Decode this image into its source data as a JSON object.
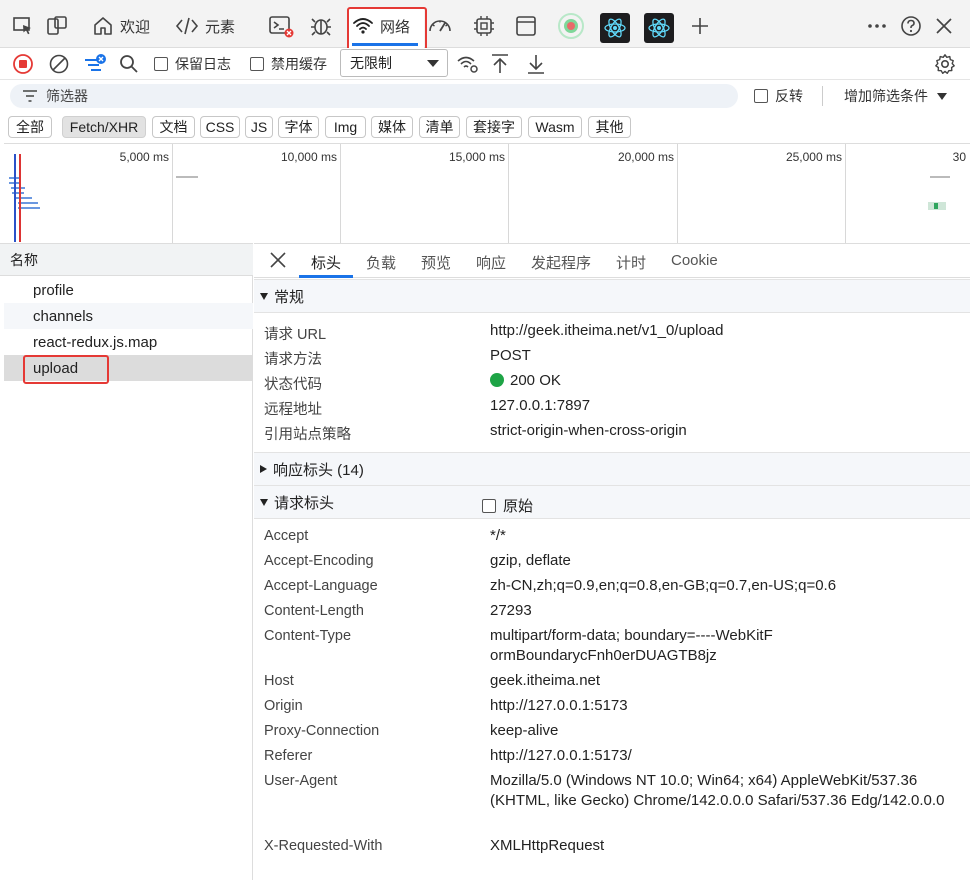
{
  "tabbar": {
    "welcome_label": "欢迎",
    "elements_label": "元素",
    "network_label": "网络"
  },
  "toolbar": {
    "preserve_log_label": "保留日志",
    "disable_cache_label": "禁用缓存",
    "throttling_value": "无限制"
  },
  "filter": {
    "placeholder": "筛选器",
    "invert_label": "反转",
    "more_filters_label": "增加筛选条件"
  },
  "type_filters": [
    "全部",
    "Fetch/XHR",
    "文档",
    "CSS",
    "JS",
    "字体",
    "Img",
    "媒体",
    "清单",
    "套接字",
    "Wasm",
    "其他"
  ],
  "selected_type_filter": "Fetch/XHR",
  "overview": {
    "ticks": [
      "5,000 ms",
      "10,000 ms",
      "15,000 ms",
      "20,000 ms",
      "25,000 ms",
      "30"
    ]
  },
  "requests": {
    "header": "名称",
    "items": [
      "profile",
      "channels",
      "react-redux.js.map",
      "upload"
    ],
    "selected": "upload"
  },
  "detail": {
    "tabs": [
      "标头",
      "负载",
      "预览",
      "响应",
      "发起程序",
      "计时",
      "Cookie"
    ],
    "active_tab": "标头",
    "general": {
      "title": "常规",
      "rows": [
        {
          "key": "请求 URL",
          "value": "http://geek.itheima.net/v1_0/upload"
        },
        {
          "key": "请求方法",
          "value": "POST"
        },
        {
          "key": "状态代码",
          "value": "200 OK"
        },
        {
          "key": "远程地址",
          "value": "127.0.0.1:7897"
        },
        {
          "key": "引用站点策略",
          "value": "strict-origin-when-cross-origin"
        }
      ]
    },
    "response_headers": {
      "title": "响应标头 (14)"
    },
    "request_headers": {
      "title": "请求标头",
      "raw_label": "原始",
      "rows": [
        {
          "key": "Accept",
          "value": "*/*"
        },
        {
          "key": "Accept-Encoding",
          "value": "gzip, deflate"
        },
        {
          "key": "Accept-Language",
          "value": "zh-CN,zh;q=0.9,en;q=0.8,en-GB;q=0.7,en-US;q=0.6"
        },
        {
          "key": "Content-Length",
          "value": "27293"
        },
        {
          "key": "Content-Type",
          "value": "multipart/form-data; boundary=----WebKitFormBoundarycFnh0erDUAGTB8jz"
        },
        {
          "key": "Host",
          "value": "geek.itheima.net"
        },
        {
          "key": "Origin",
          "value": "http://127.0.0.1:5173"
        },
        {
          "key": "Proxy-Connection",
          "value": "keep-alive"
        },
        {
          "key": "Referer",
          "value": "http://127.0.0.1:5173/"
        },
        {
          "key": "User-Agent",
          "value": "Mozilla/5.0 (Windows NT 10.0; Win64; x64) AppleWebKit/537.36 (KHTML, like Gecko) Chrome/142.0.0.0 Safari/537.36 Edg/142.0.0.0"
        },
        {
          "key": "X-Requested-With",
          "value": "XMLHttpRequest"
        }
      ]
    }
  },
  "colors": {
    "accent": "#1a73e8",
    "highlight_box": "#e53935",
    "status_ok": "#1ea446",
    "record_stop": "#e53935"
  }
}
